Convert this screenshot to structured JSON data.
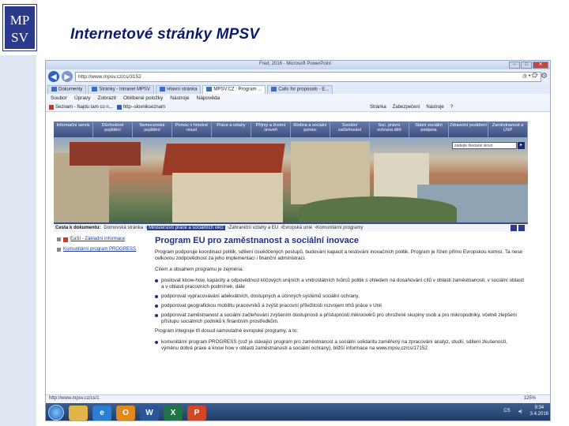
{
  "slide": {
    "logo": "MPSV",
    "title": "Internetové stránky MPSV"
  },
  "browser": {
    "window_title": "Fred, 2016 - Microsoft PowerPoint",
    "address": "http://www.mpsv.cz/cs/3152",
    "tabs": [
      "Dokumenty",
      "Stránky - Intranet MPSV",
      "Hlavní stránka",
      "MPSV.CZ : Program ...",
      "Calls for proposals - E..."
    ],
    "menu": [
      "Soubor",
      "Úpravy",
      "Zobrazit",
      "Oblíbené položky",
      "Nástroje",
      "Nápověda"
    ],
    "favorites": [
      "Seznam - Najdu tam co n...",
      "http--slovnikseznam"
    ],
    "commands": [
      "Stránka",
      "Zabezpečení",
      "Nástroje"
    ],
    "status_url": "http://www.mpsv.cz/cs/1",
    "zoom": "125%"
  },
  "site": {
    "nav": [
      "Informační servis",
      "Důchodové pojištění",
      "Nemocenské pojištění",
      "Pomoc v hmotné nouzi",
      "Práce a vztahy",
      "Příjmy a životní úroveň",
      "Rodina a sociální pomoc",
      "Sociální začleňování",
      "Soc. právní ochrana dětí",
      "Státní sociální podpora",
      "Zdravotní postižení",
      "Zaměstnanost a ÚSP"
    ],
    "search_placeholder": "zadejte hledané slovo",
    "breadcrumb_label": "Cesta k dokumentu:",
    "breadcrumbs": [
      "Domovská stránka",
      "Ministerstvo práce a sociálních věcí",
      "Zahraniční vztahy a EU",
      "Evropská unie",
      "Komunitární programy"
    ],
    "sidebar": [
      "EaSI - Základní informace",
      "Komunitární program PROGRESS"
    ],
    "heading": "Program EU pro zaměstnanost a sociální inovace",
    "intro": "Program podporuje koordinaci politik, sdílení osvědčených postupů, budování kapacit a testování inovačních politik. Program je řízen přímo Evropskou komisí. Ta nese celkovou zodpovědnost za jeho implementaci i finanční administraci.",
    "goals_intro": "Cílem a obsahem programu je zejména:",
    "bullets": [
      "posilovat know-how, kapacity a odpovědnost klíčových unijních a vnitrostátních tvůrců politik s ohledem na dosahování cílů v oblasti zaměstnanosti, v sociální oblasti a v oblasti pracovních podmínek, dále",
      "podporovat vypracovávání adekvátních, dostupných a účinných systémů sociální ochrany,",
      "podporovat geografickou mobilitu pracovníků a zvýšit pracovní příležitosti rozvojem trhů práce v Unii",
      "podporovat zaměstnanost a sociální začleňování zvýšením dostupnosti a přístupnosti mikroúvěrů pro ohrožené skupiny osob a pro mikropodniky, včetně zlepšení přístupu sociálních podniků k finančním prostředkům."
    ],
    "integrates_intro": "Program integruje tři dosud samostatné evropské programy, a to:",
    "programs": [
      "komunitární program PROGRESS (což je stávající program pro zaměstnanost a sociální solidaritu zaměřený na zpracování analýz, studií, sdílení zkušeností, výměnu dobré praxe a know how v oblasti zaměstnanosti a sociální ochrany), bližší informace na www.mpsv.cz/cs/17152"
    ]
  },
  "taskbar": {
    "apps": [
      "",
      "",
      "",
      "",
      "W",
      "X",
      "P"
    ],
    "lang": "CS",
    "time": "9:34",
    "date": "3.4.2016"
  }
}
